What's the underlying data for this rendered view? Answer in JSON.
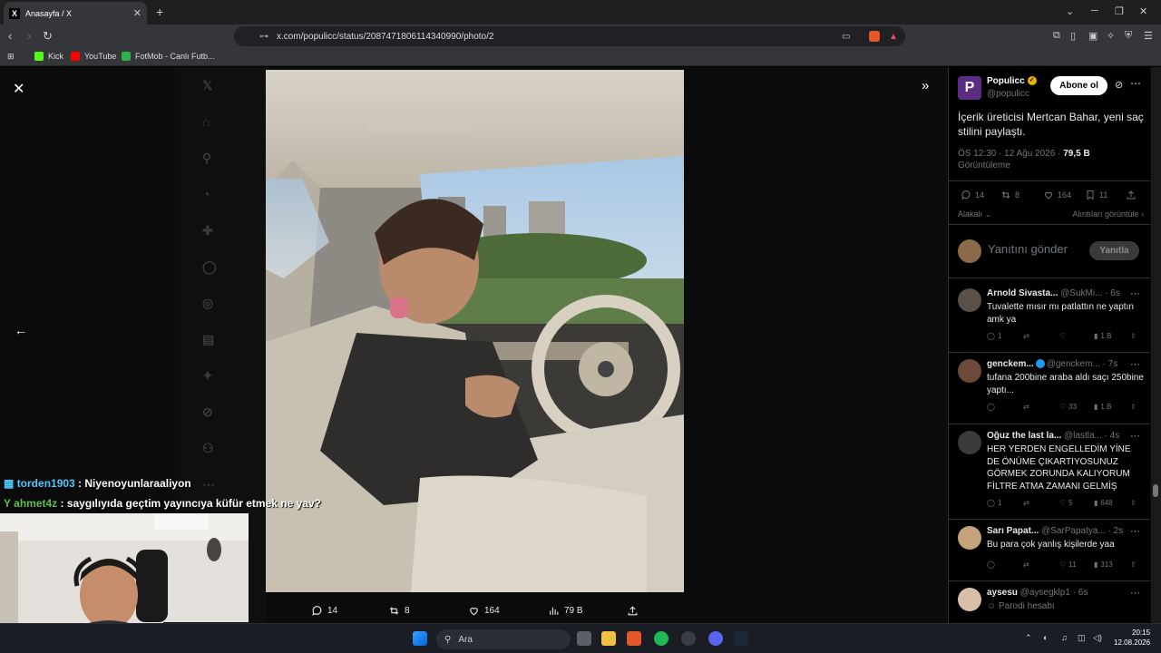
{
  "browser": {
    "tab_title": "Anasayfa / X",
    "tab_favicon": "X",
    "url": "x.com/populicc/status/2087471806114340990/photo/2",
    "bookmarks": [
      "Kick",
      "YouTube",
      "FotMob - Canlı Futb..."
    ]
  },
  "photo_actions": {
    "replies": "14",
    "reposts": "8",
    "likes": "164",
    "views": "79 B"
  },
  "post": {
    "author_name": "Populicc",
    "author_handle": "@populicc",
    "avatar_letter": "P",
    "follow_label": "Abone ol",
    "text": "İçerik üreticisi Mertcan Bahar, yeni saç stilini paylaştı.",
    "time": "ÖS 12:30 · 12 Ağu 2026 · ",
    "views_count": "79,5 B",
    "views_label": "Görüntüleme",
    "stats": {
      "replies": "14",
      "reposts": "8",
      "likes": "164",
      "bookmarks": "11"
    },
    "sort_label": "Alakalı",
    "quotes_label": "Alıntıları görüntüle",
    "reply_placeholder": "Yanıtını gönder",
    "reply_button": "Yanıtla"
  },
  "replies": [
    {
      "name": "Arnold Sivasta...",
      "handle": "@SukMi...",
      "time": "· 6s",
      "text": "Tuvalette mısır mı patlattın ne yaptın amk ya",
      "replies": "1",
      "reposts": "",
      "likes": "",
      "views": "1 B"
    },
    {
      "name": "genckem...",
      "handle": "@genckem...",
      "time": "· 7s",
      "text": "tufana 200bine araba aldı saçı 250bine yaptı...",
      "replies": "",
      "reposts": "",
      "likes": "33",
      "views": "1 B"
    },
    {
      "name": "Oğuz the last la...",
      "handle": "@lastla...",
      "time": "· 4s",
      "text": "HER YERDEN ENGELLEDİM YİNE DE ÖNÜME ÇIKARTIYOSUNUZ GÖRMEK ZORUNDA KALIYORUM FİLTRE ATMA ZAMANI GELMİŞ",
      "replies": "1",
      "reposts": "",
      "likes": "5",
      "views": "648"
    },
    {
      "name": "Sarı Papat...",
      "handle": "@SarPapatya...",
      "time": "· 2s",
      "text": "Bu para çok yanlış kişilerde yaa",
      "replies": "",
      "reposts": "",
      "likes": "11",
      "views": "313"
    },
    {
      "name": "aysesu",
      "handle": "@aysegklp1",
      "time": "· 6s",
      "text": "Parodi hesabı",
      "replies": "",
      "reposts": "",
      "likes": "",
      "views": ""
    }
  ],
  "chat": [
    {
      "user": "torden1903",
      "message": " : Niyenoyunlaraaliyon"
    },
    {
      "user": "ahmet4z",
      "message": " : saygılıyıda geçtim yayıncıya küfür etmek ne yav?"
    }
  ],
  "taskbar": {
    "search_label": "Ara",
    "time": "20:15",
    "date": "12.08.2026"
  },
  "colors": {
    "accent": "#1d9bf0",
    "verified_gold": "#e8b400",
    "brand": "#5b2d82"
  }
}
